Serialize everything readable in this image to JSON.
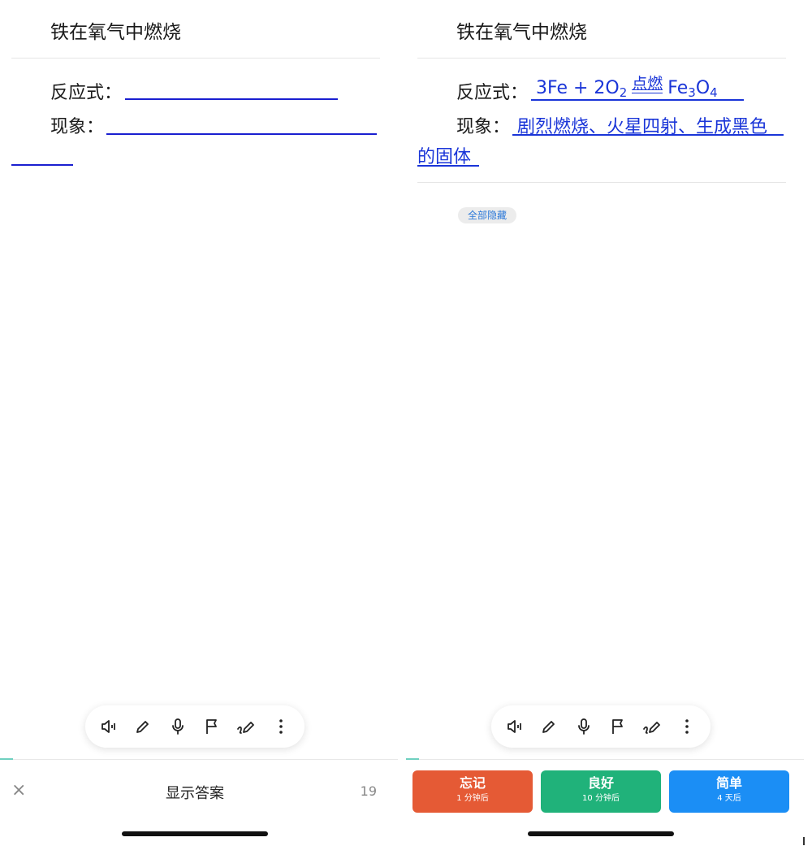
{
  "colors": {
    "blank_underline": "#1a1fd0",
    "answer_text": "#1a35d8",
    "forget": "#e55a35",
    "good": "#20b27a",
    "easy": "#1b8ef5",
    "hide_all_text": "#2b78d9"
  },
  "left": {
    "card_title": "铁在氧气中燃烧",
    "reaction_label": "反应式：",
    "phenomenon_label": "现象：",
    "footer": {
      "close_icon": "×",
      "show_answer": "显示答案",
      "count": "19"
    }
  },
  "right": {
    "card_title": "铁在氧气中燃烧",
    "reaction_label": "反应式：",
    "phenomenon_label": "现象：",
    "reaction_answer": {
      "reactant1": "3Fe + 2O",
      "reactant1_sub": "2",
      "condition": "点燃",
      "product_fe": "Fe",
      "product_fe_sub": "3",
      "product_o": "O",
      "product_o_sub": "4"
    },
    "phenomenon_answer_line1": "剧烈燃烧、火星四射、生成黑色",
    "phenomenon_answer_line2": "的固体",
    "hide_all": "全部隐藏",
    "buttons": {
      "forget_label": "忘记",
      "forget_sub": "1 分钟后",
      "good_label": "良好",
      "good_sub": "10 分钟后",
      "easy_label": "简单",
      "easy_sub": "4 天后"
    }
  },
  "toolbar_icons": [
    "speaker-icon",
    "pencil-icon",
    "microphone-icon",
    "flag-icon",
    "draw-icon",
    "more-vertical-icon"
  ]
}
